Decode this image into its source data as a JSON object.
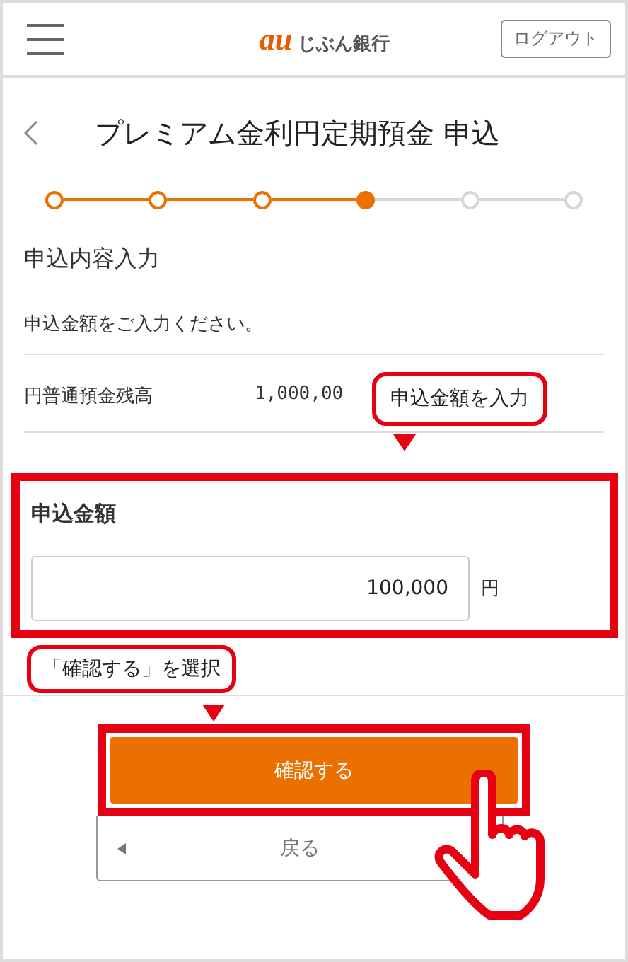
{
  "header": {
    "logo_mark": "au",
    "logo_text": "じぶん銀行",
    "logout": "ログアウト"
  },
  "title": "プレミアム金利円定期預金 申込",
  "steps": [
    {
      "reached": true,
      "selected": false
    },
    {
      "reached": true,
      "selected": false
    },
    {
      "reached": true,
      "selected": false
    },
    {
      "reached": true,
      "selected": true
    },
    {
      "reached": false,
      "selected": false
    },
    {
      "reached": false,
      "selected": false
    }
  ],
  "section_title": "申込内容入力",
  "instruction": "申込金額をご入力ください。",
  "balance": {
    "label": "円普通預金残高",
    "value": "1,000,00"
  },
  "amount": {
    "label": "申込金額",
    "value": "100,000",
    "unit": "円"
  },
  "callouts": [
    "申込金額を入力",
    "「確認する」を選択"
  ],
  "buttons": {
    "confirm": "確認する",
    "back": "戻る"
  }
}
